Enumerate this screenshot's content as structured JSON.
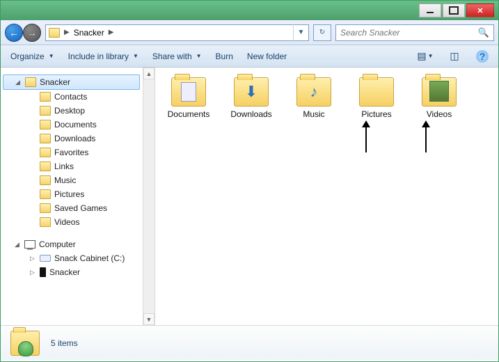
{
  "breadcrumb": {
    "root": "Snacker"
  },
  "search": {
    "placeholder": "Search Snacker"
  },
  "toolbar": {
    "organize": "Organize",
    "include": "Include in library",
    "share": "Share with",
    "burn": "Burn",
    "newfolder": "New folder"
  },
  "tree": {
    "root": "Snacker",
    "children": [
      {
        "label": "Contacts"
      },
      {
        "label": "Desktop"
      },
      {
        "label": "Documents"
      },
      {
        "label": "Downloads"
      },
      {
        "label": "Favorites"
      },
      {
        "label": "Links"
      },
      {
        "label": "Music"
      },
      {
        "label": "Pictures"
      },
      {
        "label": "Saved Games"
      },
      {
        "label": "Videos"
      }
    ],
    "computer": "Computer",
    "drive": "Snack Cabinet (C:)",
    "device": "Snacker"
  },
  "items": [
    {
      "label": "Documents",
      "overlay": "doc"
    },
    {
      "label": "Downloads",
      "overlay": "down"
    },
    {
      "label": "Music",
      "overlay": "music"
    },
    {
      "label": "Pictures",
      "overlay": "plain"
    },
    {
      "label": "Videos",
      "overlay": "media"
    }
  ],
  "status": {
    "text": "5 items"
  }
}
